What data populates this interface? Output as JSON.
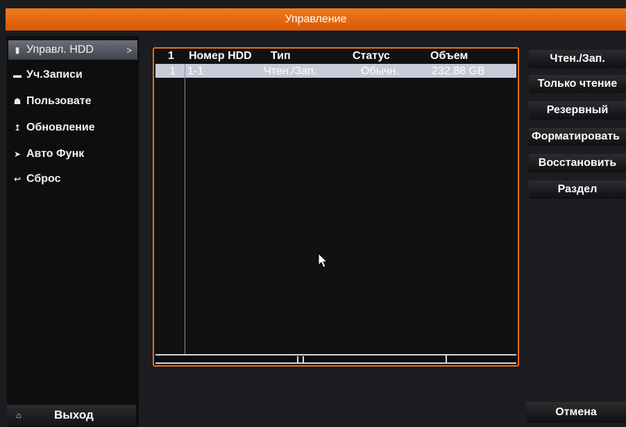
{
  "title": "Управление",
  "sidebar": {
    "items": [
      {
        "label": "Управл. HDD",
        "icon": "hdd-icon",
        "arrow": ">"
      },
      {
        "label": "Уч.Записи",
        "icon": "folder-icon"
      },
      {
        "label": "Пользовате",
        "icon": "users-icon"
      },
      {
        "label": "Обновление",
        "icon": "upgrade-icon"
      },
      {
        "label": "Авто Функ",
        "icon": "auto-icon"
      },
      {
        "label": "Сброс",
        "icon": "reset-icon"
      }
    ],
    "exit_label": "Выход"
  },
  "table": {
    "headers": [
      "1",
      "Номер HDD",
      "Тип",
      "Статус",
      "Объем"
    ],
    "rows": [
      {
        "index": "1",
        "hdd": "1-1",
        "type": "Чтен./Зап.",
        "status": "Обычн.",
        "size": "232.88 GB"
      }
    ]
  },
  "actions": {
    "rw": "Чтен./Зап.",
    "readonly": "Только чтение",
    "backup": "Резервный",
    "format": "Форматировать",
    "restore": "Восстановить",
    "partition": "Раздел",
    "cancel": "Отмена"
  },
  "colors": {
    "accent": "#e96f16",
    "selected_row": "#c7cbd8",
    "active_item": "#5a5e66"
  }
}
